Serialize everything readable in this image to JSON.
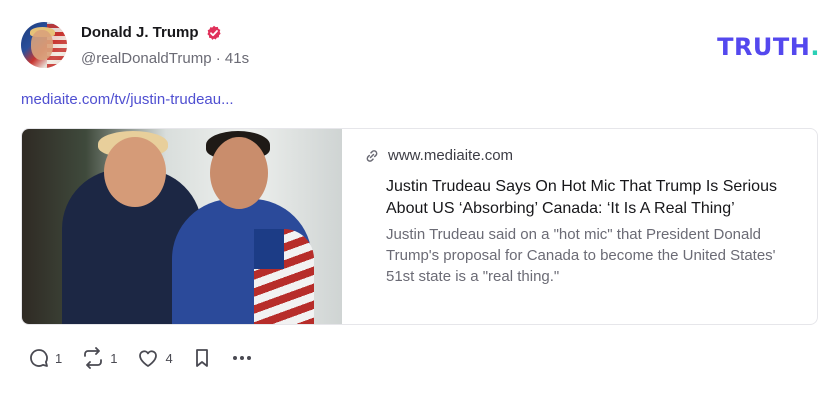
{
  "post": {
    "author_name": "Donald J. Trump",
    "handle": "@realDonaldTrump",
    "separator": "·",
    "time": "41s",
    "link_text": "mediaite.com/tv/justin-trudeau..."
  },
  "brand": {
    "logo_text": "TRUTH",
    "logo_dot": ".",
    "accent": "#5448ee",
    "dot_color": "#2ad0b5"
  },
  "card": {
    "domain": "www.mediaite.com",
    "title": "Justin Trudeau Says On Hot Mic That Trump Is Serious About US ‘Absorbing’ Canada: ‘It Is A Real Thing’",
    "description": "Justin Trudeau said on a \"hot mic\" that President Donald Trump's proposal for Canada to become the United States' 51st state is a \"real thing.\""
  },
  "actions": {
    "replies": "1",
    "retruths": "1",
    "likes": "4"
  },
  "icons": [
    "verified-badge-icon",
    "link-icon",
    "reply-icon",
    "retruth-icon",
    "like-icon",
    "bookmark-icon",
    "more-icon"
  ]
}
